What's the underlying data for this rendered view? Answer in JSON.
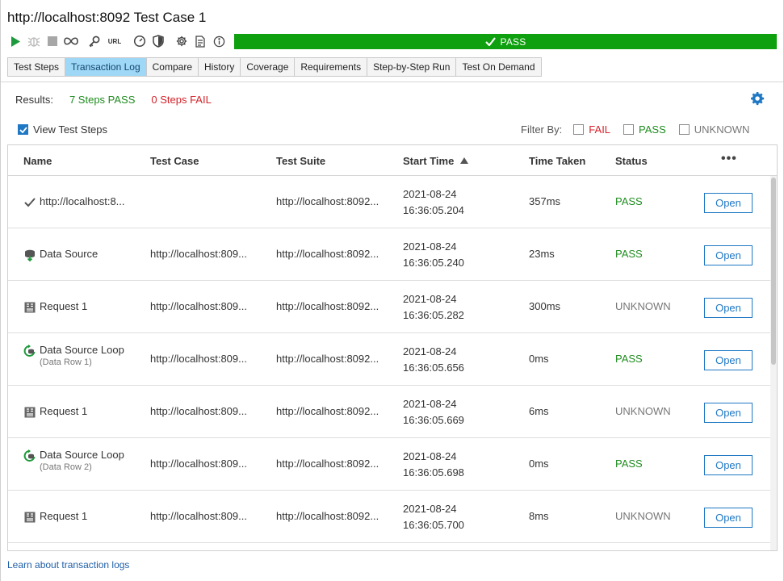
{
  "window": {
    "title": "http://localhost:8092 Test Case 1"
  },
  "toolbar": {
    "icons": [
      "play-icon",
      "debug-icon",
      "stop-icon",
      "loop-icon",
      "key-icon",
      "url-icon",
      "gauge-icon",
      "shield-icon",
      "gear-icon",
      "info-icon"
    ],
    "url_label": "URL"
  },
  "status_bar": {
    "label": "PASS",
    "color": "#0ea00e"
  },
  "tabs": [
    {
      "label": "Test Steps",
      "active": false
    },
    {
      "label": "Transaction Log",
      "active": true
    },
    {
      "label": "Compare",
      "active": false
    },
    {
      "label": "History",
      "active": false
    },
    {
      "label": "Coverage",
      "active": false
    },
    {
      "label": "Requirements",
      "active": false
    },
    {
      "label": "Step-by-Step Run",
      "active": false
    },
    {
      "label": "Test On Demand",
      "active": false
    }
  ],
  "results": {
    "label": "Results:",
    "pass_text": "7 Steps PASS",
    "fail_text": "0 Steps FAIL"
  },
  "view_steps": {
    "label": "View Test Steps",
    "checked": true
  },
  "filter": {
    "label": "Filter By:",
    "options": [
      {
        "label": "FAIL",
        "checked": false
      },
      {
        "label": "PASS",
        "checked": false
      },
      {
        "label": "UNKNOWN",
        "checked": false
      }
    ]
  },
  "table": {
    "headers": {
      "name": "Name",
      "test_case": "Test Case",
      "test_suite": "Test Suite",
      "start_time": "Start Time",
      "time_taken": "Time Taken",
      "status": "Status",
      "more": "•••"
    },
    "sort": {
      "column": "start_time",
      "direction": "ascending"
    },
    "open_label": "Open",
    "rows": [
      {
        "icon": "check-icon",
        "name": "http://localhost:8...",
        "sub": "",
        "test_case": "",
        "test_suite": "http://localhost:8092...",
        "date": "2021-08-24",
        "time": "16:36:05.204",
        "taken": "357ms",
        "status": "PASS"
      },
      {
        "icon": "data-source-icon",
        "name": "Data Source",
        "sub": "",
        "test_case": "http://localhost:809...",
        "test_suite": "http://localhost:8092...",
        "date": "2021-08-24",
        "time": "16:36:05.240",
        "taken": "23ms",
        "status": "PASS"
      },
      {
        "icon": "request-icon",
        "name": "Request 1",
        "sub": "",
        "test_case": "http://localhost:809...",
        "test_suite": "http://localhost:8092...",
        "date": "2021-08-24",
        "time": "16:36:05.282",
        "taken": "300ms",
        "status": "UNKNOWN"
      },
      {
        "icon": "data-source-loop-icon",
        "name": "Data Source Loop",
        "sub": "(Data Row 1)",
        "test_case": "http://localhost:809...",
        "test_suite": "http://localhost:8092...",
        "date": "2021-08-24",
        "time": "16:36:05.656",
        "taken": "0ms",
        "status": "PASS"
      },
      {
        "icon": "request-icon",
        "name": "Request 1",
        "sub": "",
        "test_case": "http://localhost:809...",
        "test_suite": "http://localhost:8092...",
        "date": "2021-08-24",
        "time": "16:36:05.669",
        "taken": "6ms",
        "status": "UNKNOWN"
      },
      {
        "icon": "data-source-loop-icon",
        "name": "Data Source Loop",
        "sub": "(Data Row 2)",
        "test_case": "http://localhost:809...",
        "test_suite": "http://localhost:8092...",
        "date": "2021-08-24",
        "time": "16:36:05.698",
        "taken": "0ms",
        "status": "PASS"
      },
      {
        "icon": "request-icon",
        "name": "Request 1",
        "sub": "",
        "test_case": "http://localhost:809...",
        "test_suite": "http://localhost:8092...",
        "date": "2021-08-24",
        "time": "16:36:05.700",
        "taken": "8ms",
        "status": "UNKNOWN"
      }
    ]
  },
  "footer": {
    "link": "Learn about transaction logs"
  },
  "colors": {
    "pass": "#1f8c1f",
    "fail": "#d4232a",
    "unknown": "#777777",
    "accent": "#1f78c4",
    "active_tab": "#9fd8f7"
  }
}
